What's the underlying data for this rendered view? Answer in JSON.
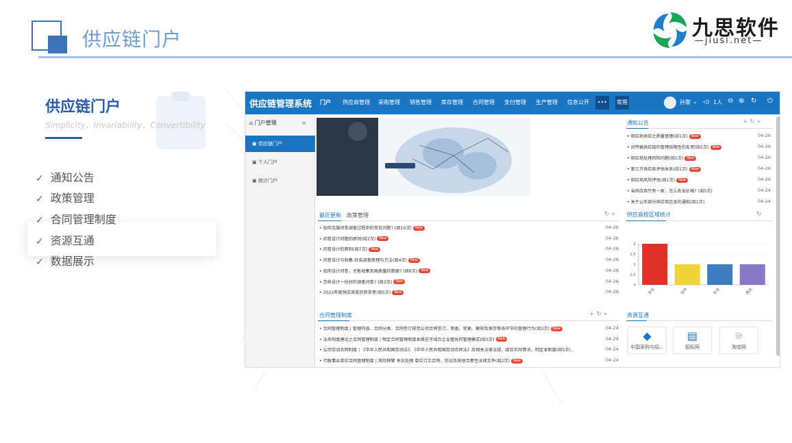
{
  "slide": {
    "title": "供应链门户",
    "brand_name": "九思软件",
    "brand_url": "—jiusi.net—"
  },
  "left": {
    "title": "供应链门户",
    "subtitle": "Simplicity、Invariability、Convertibility",
    "features": [
      "通知公告",
      "政策管理",
      "合同管理制度",
      "资源互通",
      "数据展示"
    ]
  },
  "app": {
    "system_name": "供应链管理系统",
    "nav": [
      "门户",
      "供应商管理",
      "采购管理",
      "销售管理",
      "库存管理",
      "合同管理",
      "支付管理",
      "生产管理",
      "信息公开"
    ],
    "more_label": "•••",
    "common_label": "常用",
    "user": "孙黎",
    "online": "1人",
    "sidebar": {
      "title": "门户管理",
      "items": [
        "供应链门户",
        "个人门户",
        "统计门户"
      ]
    },
    "recent": {
      "tabs": [
        "最近更新",
        "政策管理"
      ],
      "rows": [
        {
          "text": "如何克服问卷调查过程中的常见问题? (阅10次)",
          "date": "04-26",
          "new": true
        },
        {
          "text": "问卷设计问题的原则(阅7次)",
          "date": "04-26",
          "new": true
        },
        {
          "text": "问卷设计的原则(阅7次)",
          "date": "04-26",
          "new": true
        },
        {
          "text": "问卷设计与收集-社会调查原理与方法(阅4次)",
          "date": "04-26",
          "new": true
        },
        {
          "text": "如何设计问卷，才能收集到高质量的数据? (阅6次)",
          "date": "04-26",
          "new": true
        },
        {
          "text": "怎样设计一份好的调查问卷? (阅3次)",
          "date": "04-26",
          "new": true
        },
        {
          "text": "2022年度供应商奖的获奖者(阅5次)",
          "date": "04-26",
          "new": true
        }
      ]
    },
    "contract": {
      "title": "合同管理制度",
      "rows": [
        {
          "text": "合同管理制度 | 管理内容、合同分类、合同签订规范公司合同签订、审查、变更、解除及保存等各环节的管理行为(阅3次)",
          "date": "04-24",
          "new": true
        },
        {
          "text": "法务制度建设之合同管理制度 | 制定合同管理制度本质在于结合企业整体的管理模式(阅3次)",
          "date": "04-24",
          "new": true
        },
        {
          "text": "公司劳动合同制度 | 《中华人民共和国劳动法》、《中华人民共和国劳动合同法》及相关法律法规，结合实际情况，制定本制度(阅5次)...",
          "date": "04-24",
          "new": false
        },
        {
          "text": "行政事业单位合同管理制度 | 风险预警 争议处理 单位订立合同、协议及其他合意性法律文件(阅2次)",
          "date": "04-24",
          "new": true
        }
      ]
    },
    "notice": {
      "title": "通知公告",
      "rows": [
        {
          "text": "供应商供应之质量管理(阅1次)",
          "date": "04-26",
          "new": true
        },
        {
          "text": "对传输供应链的管理局限性的反思(阅1次)",
          "date": "04-26",
          "new": true
        },
        {
          "text": "供应商处理风险问题(阅1次)",
          "date": "04-26",
          "new": true
        },
        {
          "text": "第三方供应商评估体系(阅1次)",
          "date": "04-26",
          "new": true
        },
        {
          "text": "供应商风险评估(阅1次)",
          "date": "04-26",
          "new": true
        },
        {
          "text": "当供应商只有一家，怎么去谈价格? (阅5次)",
          "date": "04-24",
          "new": false
        },
        {
          "text": "关于公布部分供应商信息的通知(阅1次)",
          "date": "04-24",
          "new": false
        }
      ]
    },
    "region": {
      "title": "供应商按区域统计"
    },
    "resource": {
      "title": "资源互通",
      "items": [
        "中国采购与招...",
        "招标网",
        "淘宝网"
      ]
    }
  },
  "chart_data": {
    "type": "bar",
    "categories": [
      "华北",
      "华中",
      "东北",
      "西北"
    ],
    "values": [
      2,
      1,
      1,
      1
    ],
    "colors": [
      "#e0302a",
      "#f2d33e",
      "#3f7dbe",
      "#8a78c9"
    ],
    "ylim": [
      0,
      2
    ],
    "yticks": [
      "0",
      "0.5",
      "1",
      "1.5",
      "2"
    ],
    "grid": true
  }
}
